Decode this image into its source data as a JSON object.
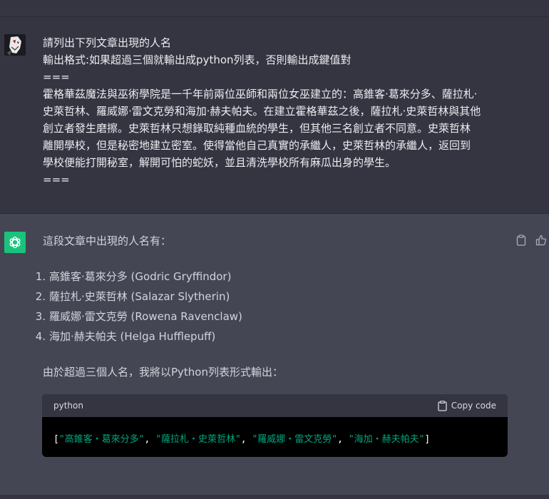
{
  "user": {
    "lines": [
      "請列出下列文章出現的人名",
      "輸出格式:如果超過三個就輸出成python列表，否則輸出成鍵值對",
      "===",
      "霍格華茲魔法與巫術學院是一千年前兩位巫師和兩位女巫建立的：高錐客‧葛來分多、薩拉札‧",
      "史萊哲林、羅威娜‧雷文克勞和海加‧赫夫帕夫。在建立霍格華茲之後，薩拉札‧史萊哲林與其他",
      "創立者發生磨擦。史萊哲林只想錄取純種血統的學生，但其他三名創立者不同意。史萊哲林",
      "離開學校，但是秘密地建立密室。使得當他自己真實的承繼人，史萊哲林的承繼人，返回到",
      "學校便能打開秘室，解開可怕的蛇妖，並且清洗學校所有麻瓜出身的學生。",
      "==="
    ]
  },
  "assistant": {
    "intro": "這段文章中出現的人名有：",
    "list": [
      {
        "num": "1.",
        "text": "高錐客‧葛來分多 (Godric Gryffindor)"
      },
      {
        "num": "2.",
        "text": "薩拉札‧史萊哲林 (Salazar Slytherin)"
      },
      {
        "num": "3.",
        "text": "羅威娜‧雷文克勞 (Rowena Ravenclaw)"
      },
      {
        "num": "4.",
        "text": "海加‧赫夫帕夫 (Helga Hufflepuff)"
      }
    ],
    "conclusion": "由於超過三個人名，我將以Python列表形式輸出：",
    "code": {
      "language": "python",
      "copy_label": "Copy code",
      "open": "[",
      "items": [
        "\"高錐客‧葛來分多\"",
        "\"薩拉札‧史萊哲林\"",
        "\"羅威娜‧雷文克勞\"",
        "\"海加‧赫夫帕夫\""
      ],
      "sep": ", ",
      "close": "]"
    }
  },
  "colors": {
    "background": "#343541",
    "assistant_bg": "#444654",
    "accent": "#19c37d",
    "code_string": "#00a67d"
  }
}
